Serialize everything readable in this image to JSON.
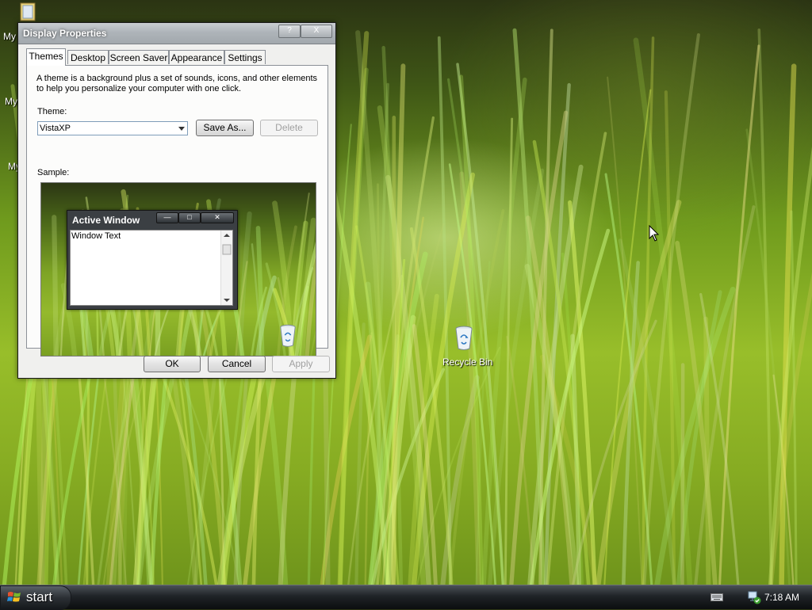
{
  "desktop": {
    "icons": [
      {
        "label": "My",
        "icon": "my-documents-icon"
      },
      {
        "label": "My",
        "icon": "my-computer-icon"
      },
      {
        "label": "My",
        "icon": "my-network-places-icon"
      },
      {
        "label": "Recycle Bin",
        "icon": "recycle-bin-icon"
      }
    ]
  },
  "dialog": {
    "title": "Display Properties",
    "title_buttons": [
      "?",
      "X"
    ],
    "tabs": [
      "Themes",
      "Desktop",
      "Screen Saver",
      "Appearance",
      "Settings"
    ],
    "active_tab": "Themes",
    "description": "A theme is a background plus a set of sounds, icons, and other elements to help you personalize your computer with one click.",
    "theme_label": "Theme:",
    "theme_value": "VistaXP",
    "save_as_label": "Save As...",
    "delete_label": "Delete",
    "sample_label": "Sample:",
    "sample": {
      "window_title": "Active Window",
      "window_text": "Window Text",
      "buttons": [
        "minimize",
        "maximize",
        "close"
      ]
    },
    "ok_label": "OK",
    "cancel_label": "Cancel",
    "apply_label": "Apply"
  },
  "taskbar": {
    "start_label": "start",
    "clock": "7:18 AM",
    "tray_icons": [
      "keyboard-icon",
      "network-security-icon"
    ]
  },
  "colors": {
    "wallpaper_green": "#8db52a",
    "taskbar": "#1f2327",
    "titlebar": "#aeb4b9"
  }
}
